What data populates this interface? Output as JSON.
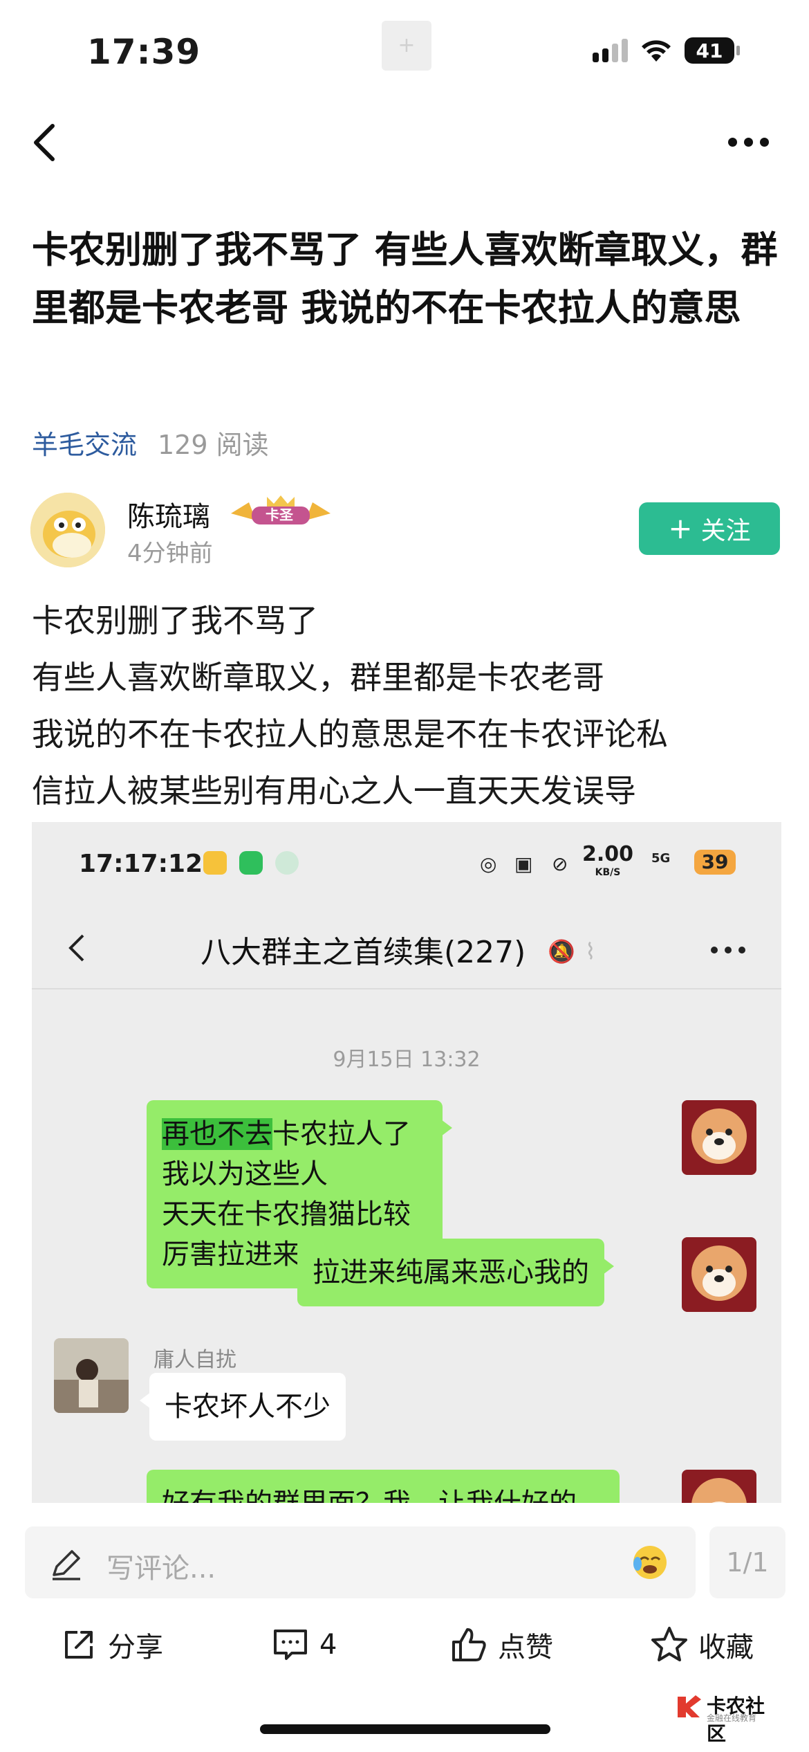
{
  "status_bar": {
    "time": "17:39",
    "center_glyph": "+",
    "battery": "41"
  },
  "nav": {
    "back_icon": "chevron-left-icon",
    "more_icon": "more-dots-icon"
  },
  "post": {
    "title": "卡农别删了我不骂了 有些人喜欢断章取义，群里都是卡农老哥 我说的不在卡农拉人的意思",
    "category": "羊毛交流",
    "reads": "129 阅读",
    "author": {
      "name": "陈琉璃",
      "badge": "卡圣",
      "time": "4分钟前"
    },
    "follow_label": "关注",
    "body_lines": [
      "卡农别删了我不骂了",
      "有些人喜欢断章取义，群里都是卡农老哥",
      "我说的不在卡农拉人的意思是不在卡农评论私",
      "信拉人被某些别有用心之人一直天天发误导"
    ]
  },
  "screenshot": {
    "status_time": "17:17:12",
    "net_speed": "2.00",
    "net_unit": "KB/S",
    "net_type": "5G",
    "battery": "39",
    "chat_title": "八大群主之首续集(227)",
    "date": "9月15日 13:32",
    "messages": [
      {
        "side": "right",
        "highlight": "再也不去",
        "line1": "卡农拉人了我以为这些人",
        "line2": "天天在卡农撸猫比较厉害拉进来"
      },
      {
        "side": "right",
        "text": "拉进来纯属来恶心我的"
      },
      {
        "side": "left",
        "sender": "庸人自扰",
        "text": "卡农坏人不少"
      },
      {
        "side": "right",
        "text": "好有我的群里面？我，让我什好的"
      }
    ]
  },
  "bottom": {
    "comment_placeholder": "写评论...",
    "page": "1/1",
    "share": "分享",
    "comments": "4",
    "like": "点赞",
    "favorite": "收藏"
  },
  "watermark": {
    "name": "卡农社区",
    "sub": "金融在线教育"
  },
  "colors": {
    "accent": "#2cbc92",
    "category": "#2d5b9e",
    "chat_green": "#95ec69"
  }
}
